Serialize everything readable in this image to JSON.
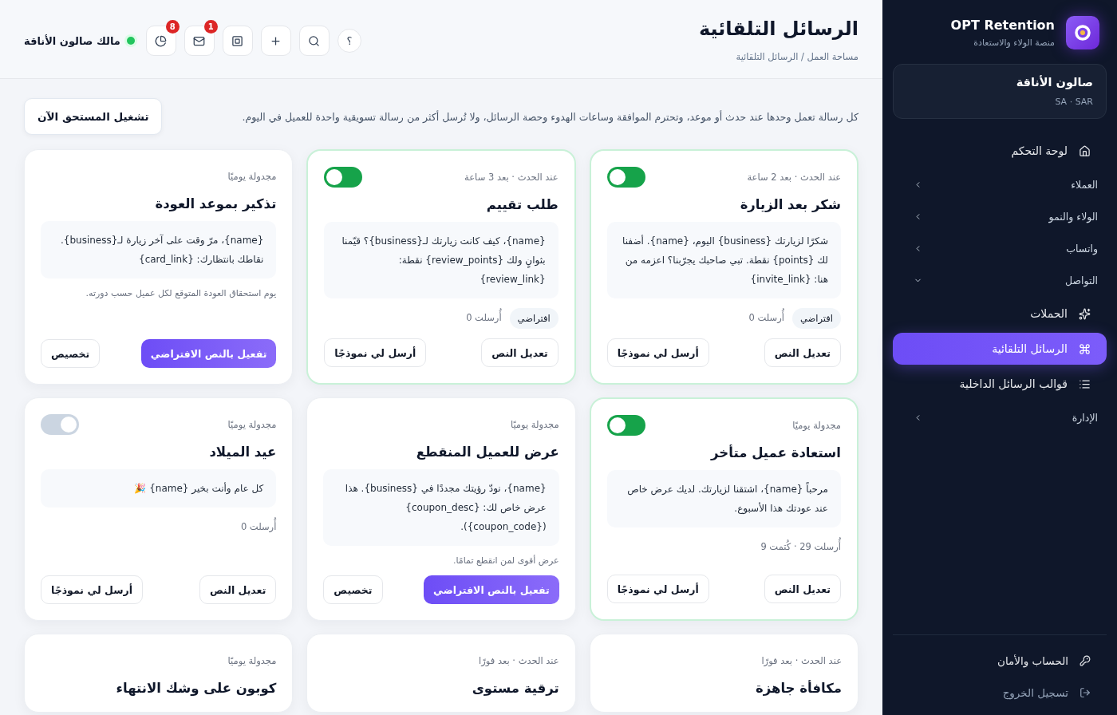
{
  "sidebar": {
    "brand": {
      "name": "OPT Retention",
      "tagline": "منصة الولاء والاستعادة"
    },
    "business": {
      "name": "صالون الأناقة",
      "region": "SA · SAR"
    },
    "nav": [
      {
        "kind": "link",
        "label": "لوحة التحكم",
        "selected": false
      },
      {
        "kind": "group",
        "label": "العملاء",
        "expanded": false
      },
      {
        "kind": "group",
        "label": "الولاء والنمو",
        "expanded": false
      },
      {
        "kind": "group",
        "label": "واتساب",
        "expanded": false
      },
      {
        "kind": "group",
        "label": "التواصل",
        "expanded": true,
        "children": [
          {
            "kind": "link",
            "label": "الحملات",
            "selected": false
          },
          {
            "kind": "link",
            "label": "الرسائل التلقائية",
            "selected": true
          },
          {
            "kind": "link",
            "label": "قوالب الرسائل الداخلية",
            "selected": false
          }
        ]
      },
      {
        "kind": "group",
        "label": "الإدارة",
        "expanded": false
      }
    ],
    "footer": [
      {
        "label": "الحساب والأمان",
        "muted": false
      },
      {
        "label": "تسجيل الخروج",
        "muted": true
      }
    ]
  },
  "header": {
    "title": "الرسائل التلقائية",
    "breadcrumb": "مساحة العمل / الرسائل التلقائية",
    "toolbar": [
      {
        "kind": "text",
        "glyph": "؟"
      },
      {
        "kind": "search"
      },
      {
        "kind": "plus"
      },
      {
        "kind": "stop"
      },
      {
        "kind": "mail",
        "badge": "1"
      },
      {
        "kind": "chart",
        "badge": "8"
      }
    ],
    "user": {
      "name": "مالك صالون الأناقة",
      "online": true
    }
  },
  "intro": "كل رسالة تعمل وحدها عند حدث أو موعد، وتحترم الموافقة وساعات الهدوء وحصة الرسائل، ولا تُرسل أكثر من رسالة تسويقية واحدة للعميل في اليوم.",
  "run_button": "تشغيل المستحق الآن",
  "cards": [
    {
      "kind": "active",
      "enabled": true,
      "trigger": "عند الحدث · بعد 2 ساعة",
      "title": "شكر بعد الزيارة",
      "body": "شكرًا لزيارتك {business} اليوم، {name}. أضفنا لك {points} نقطة. تبي صاحبك يجرّبنا؟ اعزمه من هنا: {invite_link}",
      "badge": "افتراضي",
      "stats": "أُرسلت 0",
      "buttons": [
        {
          "kind": "secondary",
          "label": "تعديل النص"
        },
        {
          "kind": "secondary",
          "label": "أرسل لي نموذجًا"
        }
      ]
    },
    {
      "kind": "active",
      "enabled": true,
      "trigger": "عند الحدث · بعد 3 ساعة",
      "title": "طلب تقييم",
      "body": "{name}، كيف كانت زيارتك لـ{business}؟ قيّمنا بثوانٍ ولك {review_points} نقطة: {review_link}",
      "badge": "افتراضي",
      "stats": "أُرسلت 0",
      "buttons": [
        {
          "kind": "secondary",
          "label": "تعديل النص"
        },
        {
          "kind": "secondary",
          "label": "أرسل لي نموذجًا"
        }
      ]
    },
    {
      "kind": "available",
      "trigger": "مجدولة يوميًا",
      "title": "تذكير بموعد العودة",
      "body": "{name}، مرّ وقت على آخر زيارة لـ{business}. نقاطك بانتظارك: {card_link}",
      "note": "يوم استحقاق العودة المتوقع لكل عميل حسب دورته.",
      "buttons": [
        {
          "kind": "primary",
          "label": "تفعيل بالنص الافتراضي"
        },
        {
          "kind": "secondary",
          "label": "تخصيص"
        }
      ]
    },
    {
      "kind": "active",
      "enabled": true,
      "trigger": "مجدولة يوميًا",
      "title": "استعادة عميل متأخر",
      "body": "مرحباً {name}، اشتقنا لزيارتك. لديك عرض خاص عند عودتك هذا الأسبوع.",
      "stats": "أُرسلت 29 · كُتمت 9",
      "buttons": [
        {
          "kind": "secondary",
          "label": "تعديل النص"
        },
        {
          "kind": "secondary",
          "label": "أرسل لي نموذجًا"
        }
      ]
    },
    {
      "kind": "available",
      "trigger": "مجدولة يوميًا",
      "title": "عرض للعميل المنقطع",
      "body": "{name}، نودّ رؤيتك مجددًا في {business}. هذا عرض خاص لك: {coupon_desc} ({coupon_code}).",
      "note": "عرض أقوى لمن انقطع تمامًا.",
      "buttons": [
        {
          "kind": "primary",
          "label": "تفعيل بالنص الافتراضي"
        },
        {
          "kind": "secondary",
          "label": "تخصيص"
        }
      ]
    },
    {
      "kind": "active",
      "enabled": false,
      "trigger": "مجدولة يوميًا",
      "title": "عيد الميلاد",
      "body": "كل عام وأنت بخير {name} 🎉",
      "stats": "أُرسلت 0",
      "buttons": [
        {
          "kind": "secondary",
          "label": "تعديل النص"
        },
        {
          "kind": "secondary",
          "label": "أرسل لي نموذجًا"
        }
      ]
    },
    {
      "kind": "available",
      "trigger": "عند الحدث · بعد فورًا",
      "title": "مكافأة جاهزة"
    },
    {
      "kind": "available",
      "trigger": "عند الحدث · بعد فورًا",
      "title": "ترقية مستوى"
    },
    {
      "kind": "available",
      "trigger": "مجدولة يوميًا",
      "title": "كوبون على وشك الانتهاء"
    }
  ]
}
